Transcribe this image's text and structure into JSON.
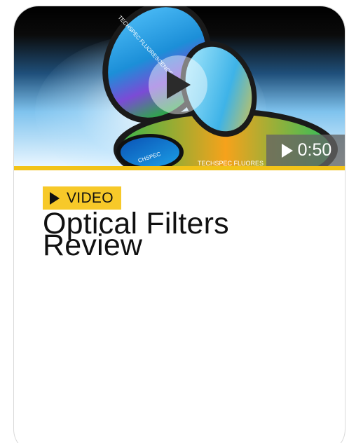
{
  "card": {
    "video": {
      "duration": "0:50",
      "thumbnail_icons": [
        "filter-lens",
        "play-circle"
      ],
      "brand_text_top": "TECHSPEC FLUORESCENCE",
      "brand_text_bottom": "TECHSPEC FLUORES",
      "brand_text_left": "CHSPEC"
    },
    "tag": {
      "icon": "play-triangle-icon",
      "label": "VIDEO"
    },
    "title": "Optical Filters Review",
    "colors": {
      "accent": "#f2c318",
      "tag_background": "#f7c929",
      "text": "#111111"
    }
  }
}
